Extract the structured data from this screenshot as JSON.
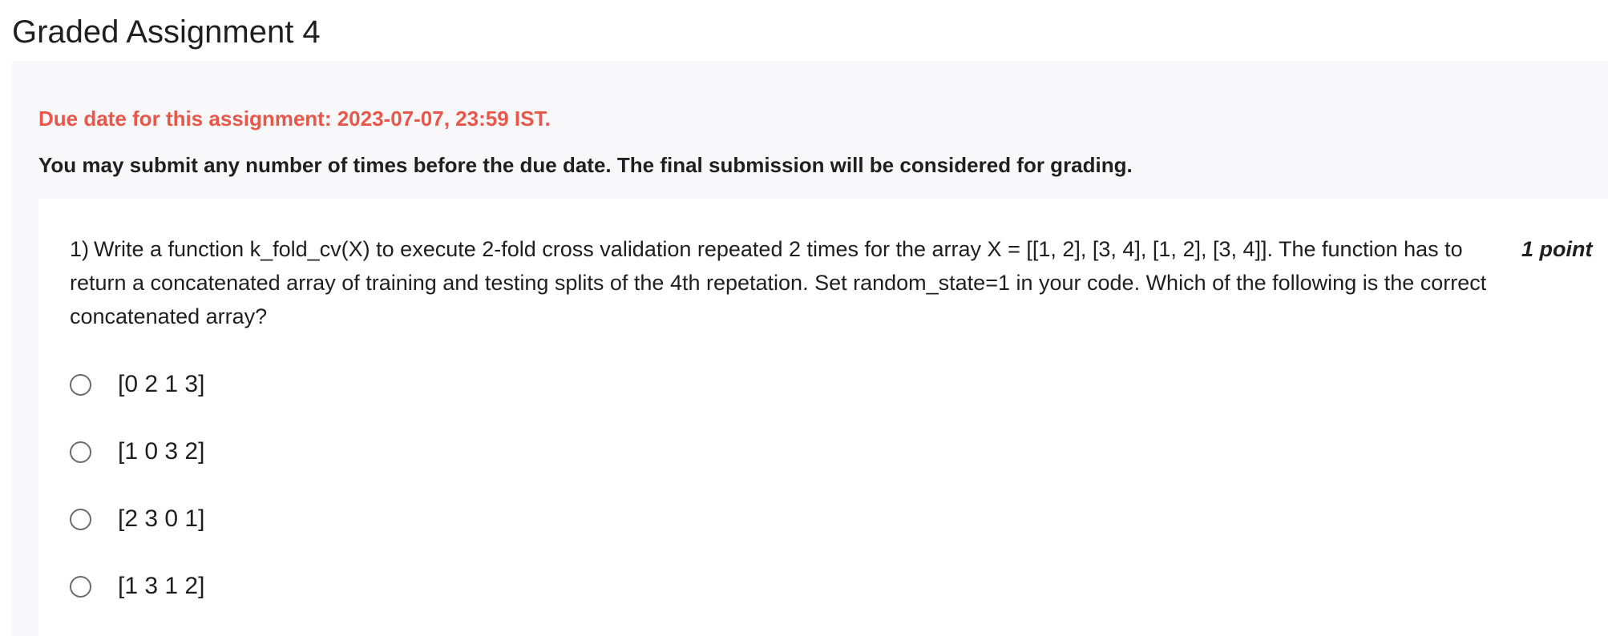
{
  "page": {
    "title": "Graded Assignment 4"
  },
  "assignment": {
    "due_date": "Due date for this assignment: 2023-07-07, 23:59 IST.",
    "submission_note": "You may submit any number of times before the due date. The final submission will be considered for grading."
  },
  "question": {
    "number": "1)",
    "lines": [
      "Write a function k_fold_cv(X) to execute 2-fold cross validation repeated 2 times for the array X = [[1, 2], [3, 4], [1, 2], [3, 4]]. The function has to",
      "return a concatenated array of training and testing splits of the 4th repetation. Set random_state=1 in your code. Which of the following is the correct",
      "concatenated array?"
    ],
    "points": "1 point",
    "options": [
      {
        "label": "[0 2 1 3]",
        "selected": false
      },
      {
        "label": "[1 0 3 2]",
        "selected": false
      },
      {
        "label": "[2 3 0 1]",
        "selected": false
      },
      {
        "label": "[1 3 1 2]",
        "selected": false
      }
    ]
  }
}
